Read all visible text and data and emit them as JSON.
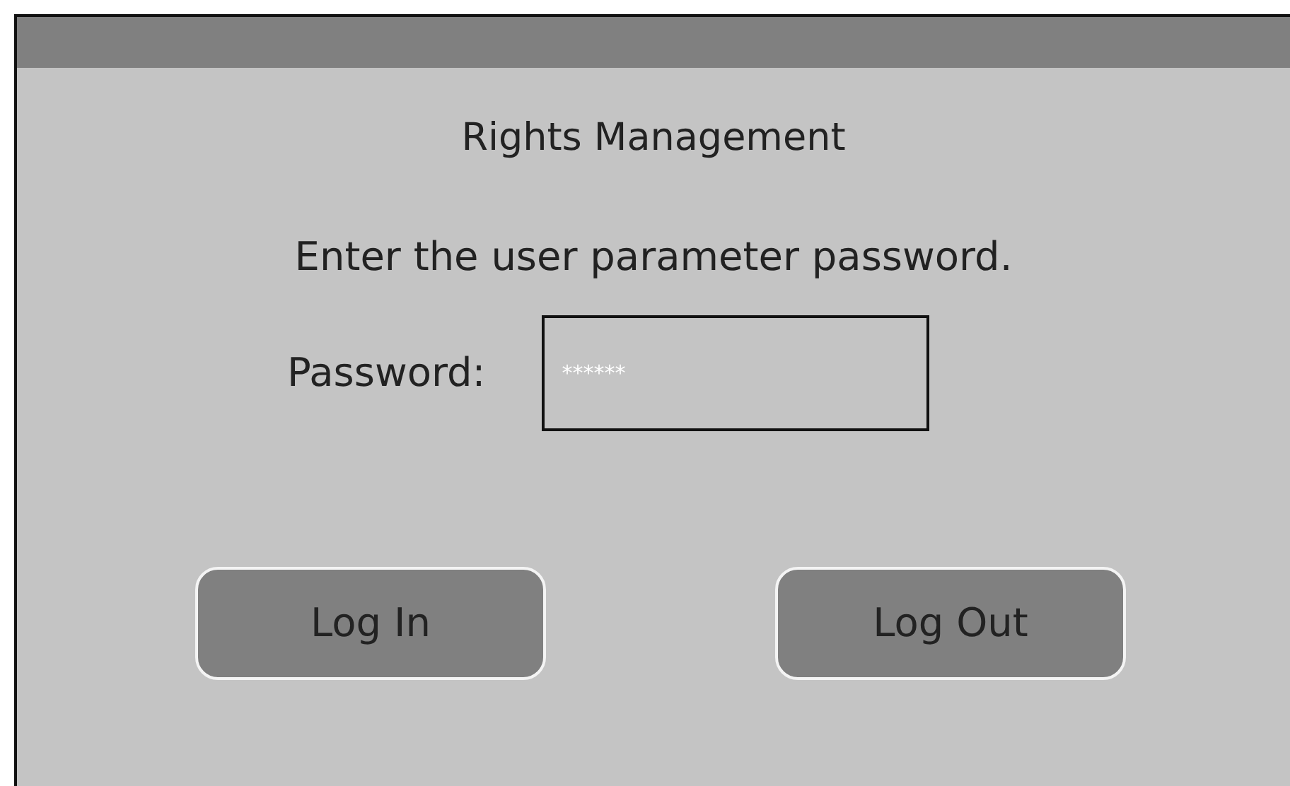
{
  "window": {
    "title": "Rights Management"
  },
  "message": "Enter the user parameter password.",
  "password": {
    "label": "Password:",
    "value": "******"
  },
  "buttons": [
    {
      "label": "Log In"
    },
    {
      "label": "Log Out"
    }
  ]
}
